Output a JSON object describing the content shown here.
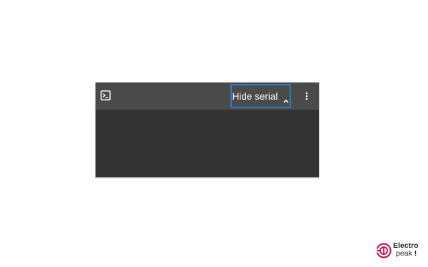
{
  "serial_panel": {
    "toolbar": {
      "terminal_icon": "terminal-icon",
      "hide_serial_label": "Hide serial",
      "chevron_icon": "chevron-up-icon",
      "more_icon": "more-vertical-icon"
    },
    "colors": {
      "toolbar_bg": "#4a4a4a",
      "body_bg": "#333333",
      "highlight_border": "#2e7bc4",
      "text": "#ffffff"
    }
  },
  "watermark": {
    "line1": "Electro",
    "line2": "peak",
    "mark": "!",
    "brand_color": "#c2185b"
  }
}
